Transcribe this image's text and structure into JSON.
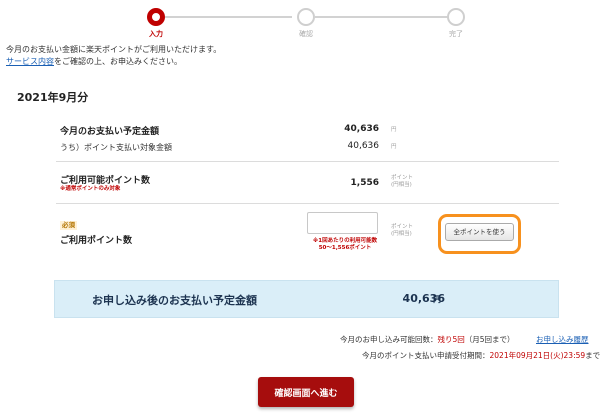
{
  "stepper": {
    "steps": [
      {
        "label": "入力",
        "state": "active"
      },
      {
        "label": "確認",
        "state": "inactive"
      },
      {
        "label": "完了",
        "state": "inactive"
      }
    ]
  },
  "intro": {
    "line1": "今月のお支払い金額に楽天ポイントがご利用いただけます。",
    "link": "サービス内容",
    "line2_rest": "をご確認の上、お申込みください。"
  },
  "month_title": "2021年9月分",
  "rows": {
    "payment": {
      "label": "今月のお支払い予定金額",
      "amount": "40,636",
      "unit": "円"
    },
    "eligible": {
      "label": "うち）ポイント支払い対象金額",
      "amount": "40,636",
      "unit": "円"
    },
    "available": {
      "label": "ご利用可能ポイント数",
      "note": "※通常ポイントのみ対象",
      "amount": "1,556",
      "unit": "ポイント",
      "unit_sub": "(円相当)"
    },
    "use": {
      "badge": "必須",
      "label": "ご利用ポイント数",
      "input_value": "",
      "unit": "ポイント",
      "unit_sub": "(円相当)",
      "limit_note": "※1回あたりの利用可能数",
      "limit_range": "50～1,556ポイント",
      "all_button": "全ポイントを使う"
    }
  },
  "total": {
    "label": "お申し込み後のお支払い予定金額",
    "amount": "40,636",
    "unit": "円"
  },
  "info": {
    "remaining_prefix": "今月のお申し込み可能回数：",
    "remaining_value": "残り5回",
    "remaining_suffix": "（月5回まで）",
    "history_link": "お申し込み履歴",
    "deadline_prefix": "今月のポイント支払い申請受付期間：",
    "deadline_value": "2021年09月21日(火)23:59",
    "deadline_suffix": "まで"
  },
  "confirm_button": "確認画面へ進む",
  "colors": {
    "accent_red": "#bf0000",
    "highlight_orange": "#f7911e",
    "total_bg": "#daeef8"
  }
}
